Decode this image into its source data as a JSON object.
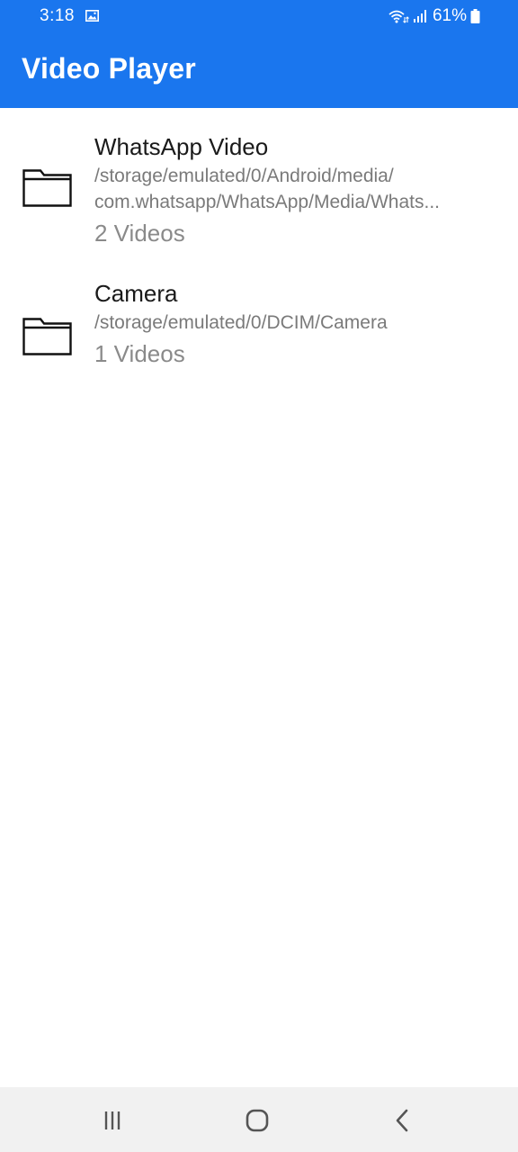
{
  "status_bar": {
    "time": "3:18",
    "battery": "61%",
    "icons": [
      "gallery-icon",
      "wifi-icon",
      "signal-icon",
      "battery-icon"
    ]
  },
  "app_bar": {
    "title": "Video Player",
    "color": "#1a76ee"
  },
  "folders": [
    {
      "name": "WhatsApp Video",
      "path_line1": "/storage/emulated/0/Android/media/",
      "path_line2": "com.whatsapp/WhatsApp/Media/Whats...",
      "count": "2 Videos",
      "icon": "folder-icon"
    },
    {
      "name": "Camera",
      "path_line1": "/storage/emulated/0/DCIM/Camera",
      "count": "1 Videos",
      "icon": "folder-icon"
    }
  ],
  "nav_bar": {
    "buttons": [
      "recents-icon",
      "home-icon",
      "back-icon"
    ]
  }
}
